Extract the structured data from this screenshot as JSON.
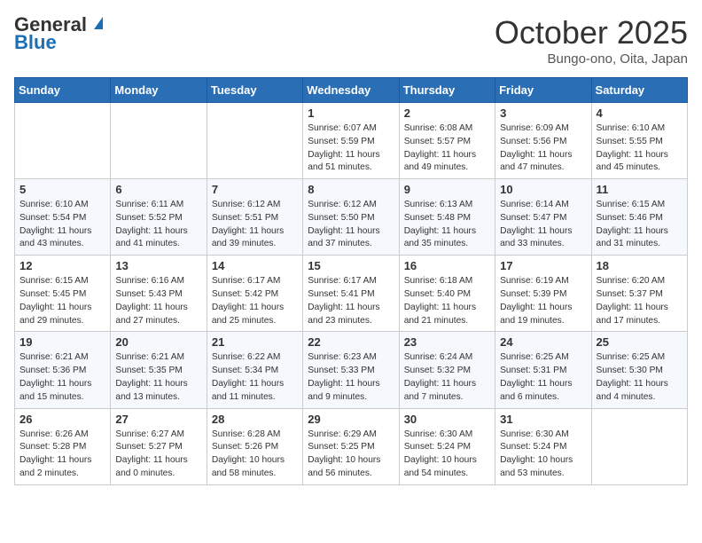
{
  "header": {
    "logo_line1": "General",
    "logo_line2": "Blue",
    "month": "October 2025",
    "location": "Bungo-ono, Oita, Japan"
  },
  "weekdays": [
    "Sunday",
    "Monday",
    "Tuesday",
    "Wednesday",
    "Thursday",
    "Friday",
    "Saturday"
  ],
  "weeks": [
    [
      {
        "day": "",
        "info": ""
      },
      {
        "day": "",
        "info": ""
      },
      {
        "day": "",
        "info": ""
      },
      {
        "day": "1",
        "info": "Sunrise: 6:07 AM\nSunset: 5:59 PM\nDaylight: 11 hours\nand 51 minutes."
      },
      {
        "day": "2",
        "info": "Sunrise: 6:08 AM\nSunset: 5:57 PM\nDaylight: 11 hours\nand 49 minutes."
      },
      {
        "day": "3",
        "info": "Sunrise: 6:09 AM\nSunset: 5:56 PM\nDaylight: 11 hours\nand 47 minutes."
      },
      {
        "day": "4",
        "info": "Sunrise: 6:10 AM\nSunset: 5:55 PM\nDaylight: 11 hours\nand 45 minutes."
      }
    ],
    [
      {
        "day": "5",
        "info": "Sunrise: 6:10 AM\nSunset: 5:54 PM\nDaylight: 11 hours\nand 43 minutes."
      },
      {
        "day": "6",
        "info": "Sunrise: 6:11 AM\nSunset: 5:52 PM\nDaylight: 11 hours\nand 41 minutes."
      },
      {
        "day": "7",
        "info": "Sunrise: 6:12 AM\nSunset: 5:51 PM\nDaylight: 11 hours\nand 39 minutes."
      },
      {
        "day": "8",
        "info": "Sunrise: 6:12 AM\nSunset: 5:50 PM\nDaylight: 11 hours\nand 37 minutes."
      },
      {
        "day": "9",
        "info": "Sunrise: 6:13 AM\nSunset: 5:48 PM\nDaylight: 11 hours\nand 35 minutes."
      },
      {
        "day": "10",
        "info": "Sunrise: 6:14 AM\nSunset: 5:47 PM\nDaylight: 11 hours\nand 33 minutes."
      },
      {
        "day": "11",
        "info": "Sunrise: 6:15 AM\nSunset: 5:46 PM\nDaylight: 11 hours\nand 31 minutes."
      }
    ],
    [
      {
        "day": "12",
        "info": "Sunrise: 6:15 AM\nSunset: 5:45 PM\nDaylight: 11 hours\nand 29 minutes."
      },
      {
        "day": "13",
        "info": "Sunrise: 6:16 AM\nSunset: 5:43 PM\nDaylight: 11 hours\nand 27 minutes."
      },
      {
        "day": "14",
        "info": "Sunrise: 6:17 AM\nSunset: 5:42 PM\nDaylight: 11 hours\nand 25 minutes."
      },
      {
        "day": "15",
        "info": "Sunrise: 6:17 AM\nSunset: 5:41 PM\nDaylight: 11 hours\nand 23 minutes."
      },
      {
        "day": "16",
        "info": "Sunrise: 6:18 AM\nSunset: 5:40 PM\nDaylight: 11 hours\nand 21 minutes."
      },
      {
        "day": "17",
        "info": "Sunrise: 6:19 AM\nSunset: 5:39 PM\nDaylight: 11 hours\nand 19 minutes."
      },
      {
        "day": "18",
        "info": "Sunrise: 6:20 AM\nSunset: 5:37 PM\nDaylight: 11 hours\nand 17 minutes."
      }
    ],
    [
      {
        "day": "19",
        "info": "Sunrise: 6:21 AM\nSunset: 5:36 PM\nDaylight: 11 hours\nand 15 minutes."
      },
      {
        "day": "20",
        "info": "Sunrise: 6:21 AM\nSunset: 5:35 PM\nDaylight: 11 hours\nand 13 minutes."
      },
      {
        "day": "21",
        "info": "Sunrise: 6:22 AM\nSunset: 5:34 PM\nDaylight: 11 hours\nand 11 minutes."
      },
      {
        "day": "22",
        "info": "Sunrise: 6:23 AM\nSunset: 5:33 PM\nDaylight: 11 hours\nand 9 minutes."
      },
      {
        "day": "23",
        "info": "Sunrise: 6:24 AM\nSunset: 5:32 PM\nDaylight: 11 hours\nand 7 minutes."
      },
      {
        "day": "24",
        "info": "Sunrise: 6:25 AM\nSunset: 5:31 PM\nDaylight: 11 hours\nand 6 minutes."
      },
      {
        "day": "25",
        "info": "Sunrise: 6:25 AM\nSunset: 5:30 PM\nDaylight: 11 hours\nand 4 minutes."
      }
    ],
    [
      {
        "day": "26",
        "info": "Sunrise: 6:26 AM\nSunset: 5:28 PM\nDaylight: 11 hours\nand 2 minutes."
      },
      {
        "day": "27",
        "info": "Sunrise: 6:27 AM\nSunset: 5:27 PM\nDaylight: 11 hours\nand 0 minutes."
      },
      {
        "day": "28",
        "info": "Sunrise: 6:28 AM\nSunset: 5:26 PM\nDaylight: 10 hours\nand 58 minutes."
      },
      {
        "day": "29",
        "info": "Sunrise: 6:29 AM\nSunset: 5:25 PM\nDaylight: 10 hours\nand 56 minutes."
      },
      {
        "day": "30",
        "info": "Sunrise: 6:30 AM\nSunset: 5:24 PM\nDaylight: 10 hours\nand 54 minutes."
      },
      {
        "day": "31",
        "info": "Sunrise: 6:30 AM\nSunset: 5:24 PM\nDaylight: 10 hours\nand 53 minutes."
      },
      {
        "day": "",
        "info": ""
      }
    ]
  ]
}
